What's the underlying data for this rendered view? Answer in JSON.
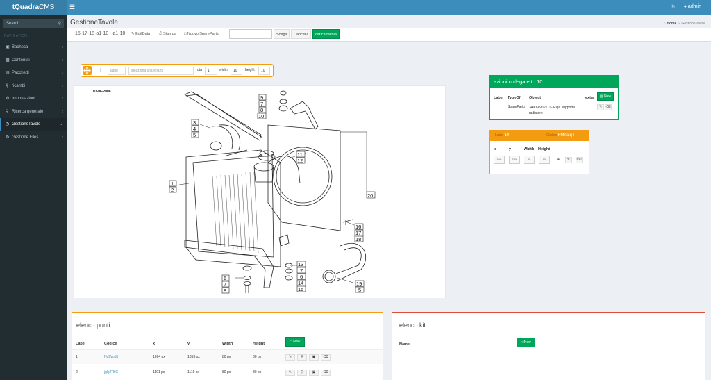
{
  "app": {
    "logo_bold": "tQuadra",
    "logo_light": "CMS",
    "user": "admin"
  },
  "sidebar": {
    "search_placeholder": "Search...",
    "nav_header": "NAVIGATION",
    "items": [
      {
        "label": "Bacheca",
        "icon": "dashboard-icon"
      },
      {
        "label": "Contenuti",
        "icon": "content-icon"
      },
      {
        "label": "Pacchetti",
        "icon": "package-icon"
      },
      {
        "label": "ricambi",
        "icon": "cart-icon"
      },
      {
        "label": "Impostazioni",
        "icon": "gear-icon"
      },
      {
        "label": "Ricerca generale",
        "icon": "search-icon"
      },
      {
        "label": "GestioneTavole",
        "icon": "clock-icon",
        "active": true
      },
      {
        "label": "Gestione Files",
        "icon": "gear-icon"
      }
    ]
  },
  "page": {
    "title": "GestioneTavole",
    "breadcrumb_home": "Home",
    "breadcrumb_current": "GestioneTavole"
  },
  "toolbar": {
    "code": "15-17-18-a1-10 - a1-10",
    "edit_data": "EditData",
    "print": "Stampa",
    "new_spareparts": "Nuovo SpareParts",
    "choose": "Scegli",
    "cancel": "Cancella",
    "upload": "carica tavola"
  },
  "edit_bar": {
    "label_placeholder": "label",
    "spareparts_placeholder": "seleziona spareparts",
    "qta_label": "qta",
    "qta_value": "1",
    "width_label": "width",
    "width_value": "10",
    "height_label": "height",
    "height_value": "10"
  },
  "drawing": {
    "date": "03-06-2008",
    "callouts": [
      "9",
      "7",
      "8",
      "10",
      "3",
      "4",
      "5",
      "11",
      "12",
      "1",
      "2",
      "20",
      "16",
      "17",
      "18",
      "13",
      "7",
      "6",
      "14",
      "15",
      "6",
      "7",
      "8",
      "19",
      "5"
    ]
  },
  "actions_box": {
    "title": "azioni collegate to 10",
    "headers": {
      "label": "Label",
      "type": "TypeOf",
      "object": "Object",
      "extra": "extra"
    },
    "new_label": "New",
    "rows": [
      {
        "label": "",
        "type": "SpareParts",
        "object": "34909589/1.0 - Riga supporto radiatore"
      }
    ]
  },
  "point_box": {
    "label_caption": "Label",
    "label_value": "10",
    "code_caption": "Codice",
    "code_value": "FMnaIqT",
    "headers": {
      "x": "x",
      "y": "y",
      "width": "Width",
      "height": "Height"
    },
    "values": {
      "x": "10%",
      "y": "37%",
      "width": "80",
      "height": "80"
    }
  },
  "points_panel": {
    "title": "elenco punti",
    "headers": {
      "label": "Label",
      "code": "Codice",
      "x": "x",
      "y": "y",
      "width": "Width",
      "height": "Height"
    },
    "new_label": "New",
    "rows": [
      {
        "label": "1",
        "code": "Nc9Vod5",
        "x": "1094 px",
        "y": "1053 px",
        "width": "80 px",
        "height": "80 px"
      },
      {
        "label": "2",
        "code": "jgkjJTBG",
        "x": "1101 px",
        "y": "1119 px",
        "width": "80 px",
        "height": "80 px"
      }
    ]
  },
  "kit_panel": {
    "title": "elenco kit",
    "header_name": "Name",
    "new_label": "New"
  },
  "colors": {
    "primary": "#3c8dbc",
    "success": "#00a65a",
    "warning": "#f39c12",
    "danger": "#dd4b39",
    "sidebar": "#222d32"
  }
}
